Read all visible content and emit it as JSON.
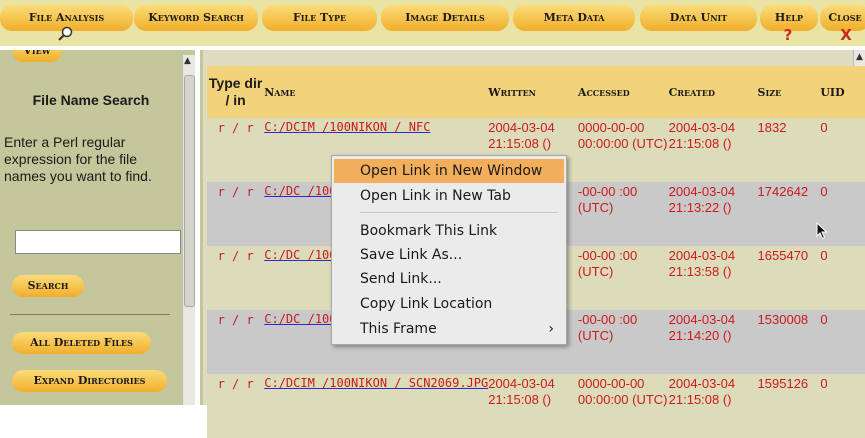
{
  "tabs": [
    {
      "label": "File Analysis",
      "icon": "magnifier-icon"
    },
    {
      "label": "Keyword Search"
    },
    {
      "label": "File Type"
    },
    {
      "label": "Image Details"
    },
    {
      "label": "Meta Data"
    },
    {
      "label": "Data Unit"
    },
    {
      "label": "Help",
      "icon_text": "?"
    },
    {
      "label": "Close",
      "icon_text": "X"
    }
  ],
  "left_panel": {
    "top_button": "View",
    "title": "File Name Search",
    "description": "Enter a Perl regular expression for the file names you want to find.",
    "search_value": "",
    "search_button": "Search",
    "all_deleted_button": "All Deleted Files",
    "expand_button": "Expand Directories"
  },
  "table": {
    "headers": {
      "type": "Type dir / in",
      "name": "Name",
      "written": "Written",
      "accessed": "Accessed",
      "created": "Created",
      "size": "Size",
      "uid": "UID"
    },
    "rows": [
      {
        "type": "r / r",
        "name": "C:/DCIM /100NIKON / NFC",
        "written": "2004-03-04 21:15:08 ()",
        "accessed": "0000-00-00 00:00:00 (UTC)",
        "created": "2004-03-04 21:15:08 ()",
        "size": "1832",
        "uid": "0"
      },
      {
        "type": "r / r",
        "name": "C:/DC /100N / SCN",
        "written": "",
        "accessed": "-00-00 :00 (UTC)",
        "created": "2004-03-04 21:13:22 ()",
        "size": "1742642",
        "uid": "0"
      },
      {
        "type": "r / r",
        "name": "C:/DC /100N / SCN",
        "written": "",
        "accessed": "-00-00 :00 (UTC)",
        "created": "2004-03-04 21:13:58 ()",
        "size": "1655470",
        "uid": "0"
      },
      {
        "type": "r / r",
        "name": "C:/DC /100N / SCN",
        "written": "",
        "accessed": "-00-00 :00 (UTC)",
        "created": "2004-03-04 21:14:20 ()",
        "size": "1530008",
        "uid": "0"
      },
      {
        "type": "r / r",
        "name": "C:/DCIM /100NIKON / SCN2069.JPG",
        "written": "2004-03-04 21:15:08 ()",
        "accessed": "0000-00-00 00:00:00 (UTC)",
        "created": "2004-03-04 21:15:08 ()",
        "size": "1595126",
        "uid": "0"
      }
    ]
  },
  "context_menu": {
    "items": [
      {
        "label": "Open Link in New Window",
        "highlighted": true
      },
      {
        "label": "Open Link in New Tab"
      },
      {
        "separator": true
      },
      {
        "label": "Bookmark This Link"
      },
      {
        "label": "Save Link As..."
      },
      {
        "label": "Send Link..."
      },
      {
        "label": "Copy Link Location"
      },
      {
        "label": "This Frame",
        "submenu": true
      }
    ]
  },
  "colors": {
    "tab_gradient_top": "#fbdc7a",
    "tab_gradient_bottom": "#f1ae2b",
    "header_bg": "#f2d27a",
    "panel_bg": "#c4c79b",
    "row_odd": "#dcdcba",
    "row_even": "#c9c9c9",
    "value_text": "#cc1a1a",
    "icon_red": "#cc2a1a",
    "menu_highlight": "#f2ae5a"
  }
}
